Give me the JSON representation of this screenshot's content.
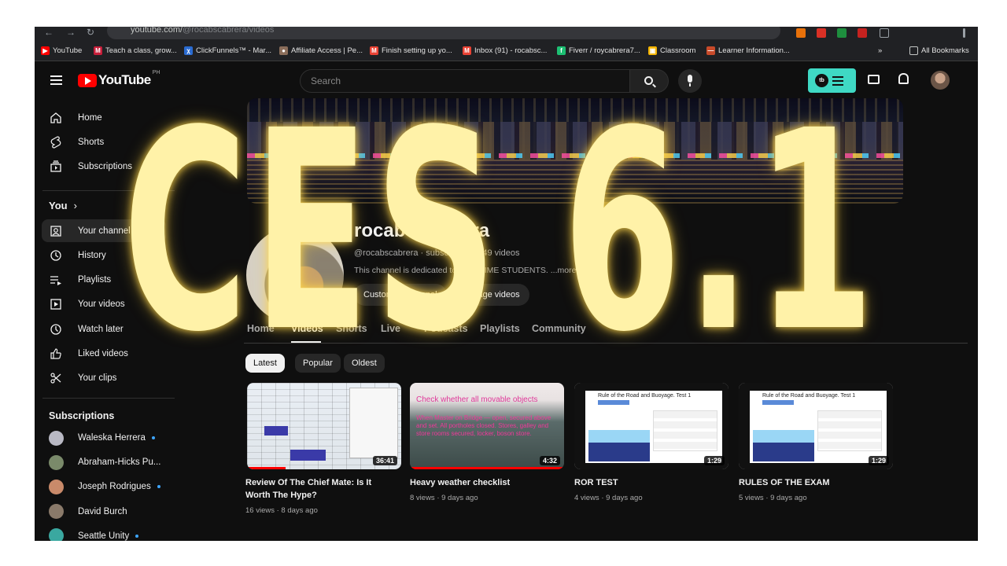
{
  "browser": {
    "url_host": "youtube.com/",
    "url_path": "@rocabscabrera/videos",
    "bookmarks": [
      {
        "label": "YouTube",
        "color": "#ff0000",
        "glyph": "▶"
      },
      {
        "label": "Teach a class, grow...",
        "color": "#c81e3a",
        "glyph": "M"
      },
      {
        "label": "ClickFunnels™ - Mar...",
        "color": "#2a6bd1",
        "glyph": "χ"
      },
      {
        "label": "Affiliate Access | Pe...",
        "color": "#8a6d5a",
        "glyph": "●"
      },
      {
        "label": "Finish setting up yo...",
        "color": "#ea4335",
        "glyph": "M"
      },
      {
        "label": "Inbox (91) - rocabsc...",
        "color": "#ea4335",
        "glyph": "M"
      },
      {
        "label": "Fiverr / roycabrera7...",
        "color": "#1dbf73",
        "glyph": "f"
      },
      {
        "label": "Classroom",
        "color": "#f4b400",
        "glyph": "▣"
      },
      {
        "label": "Learner Information...",
        "color": "#c84a2a",
        "glyph": "—"
      }
    ],
    "all_bookmarks": "All Bookmarks",
    "more": "»"
  },
  "header": {
    "logo": "YouTube",
    "country": "PH",
    "search_placeholder": "Search",
    "extension_badge": "tb"
  },
  "sidebar": {
    "main": [
      {
        "label": "Home",
        "icon": "home-icon"
      },
      {
        "label": "Shorts",
        "icon": "shorts-icon"
      },
      {
        "label": "Subscriptions",
        "icon": "subscriptions-icon"
      }
    ],
    "you_title": "You",
    "you_chevron": "›",
    "you": [
      {
        "label": "Your channel",
        "icon": "your-channel-icon"
      },
      {
        "label": "History",
        "icon": "history-icon"
      },
      {
        "label": "Playlists",
        "icon": "playlists-icon"
      },
      {
        "label": "Your videos",
        "icon": "your-videos-icon"
      },
      {
        "label": "Watch later",
        "icon": "watch-later-icon"
      },
      {
        "label": "Liked videos",
        "icon": "liked-videos-icon"
      },
      {
        "label": "Your clips",
        "icon": "clips-icon"
      }
    ],
    "subs_title": "Subscriptions",
    "subscriptions": [
      {
        "name": "Waleska Herrera",
        "color": "#b9b9c4",
        "dot": true
      },
      {
        "name": "Abraham-Hicks Pu...",
        "color": "#7a8a6a",
        "dot": false
      },
      {
        "name": "Joseph Rodrigues",
        "color": "#c98a6a",
        "dot": true
      },
      {
        "name": "David Burch",
        "color": "#8a7a6a",
        "dot": false
      },
      {
        "name": "Seattle Unity",
        "color": "#3aa8a0",
        "dot": true
      }
    ]
  },
  "channel": {
    "name": "rocabs cabrera",
    "meta": "@rocabscabrera · subscribers · 449 videos",
    "desc": "This channel is dedicated to MARITIME STUDENTS. ...more",
    "customize_btn": "Customize channel",
    "manage_btn": "Manage videos",
    "tabs": [
      "Home",
      "Videos",
      "Shorts",
      "Live",
      "Podcasts",
      "Playlists",
      "Community"
    ],
    "active_tab": "Videos",
    "chips": [
      "Latest",
      "Popular",
      "Oldest"
    ]
  },
  "videos": [
    {
      "title": "Review Of The Chief Mate: Is It Worth The Hype?",
      "meta": "16 views · 8 days ago",
      "duration": "36:41",
      "progress": 0.25
    },
    {
      "title": "Heavy weather checklist",
      "meta": "8 views · 9 days ago",
      "duration": "4:32",
      "progress": 1.0,
      "thumb_header": "Check whether all movable objects",
      "thumb_text": "When Master on Bridge — open, secured above and set. All portholes closed. Stores, galley and store rooms secured, locker, boson store."
    },
    {
      "title": "ROR TEST",
      "meta": "4 views · 9 days ago",
      "duration": "1:29",
      "progress": 0,
      "thumb_title": "Rule of the Road and Buoyage. Test 1"
    },
    {
      "title": "RULES OF THE EXAM",
      "meta": "5 views · 9 days ago",
      "duration": "1:29",
      "progress": 0,
      "thumb_title": "Rule of the Road and Buoyage. Test 1"
    }
  ],
  "overlay": {
    "line1": "CES",
    "line2": "6.1"
  }
}
